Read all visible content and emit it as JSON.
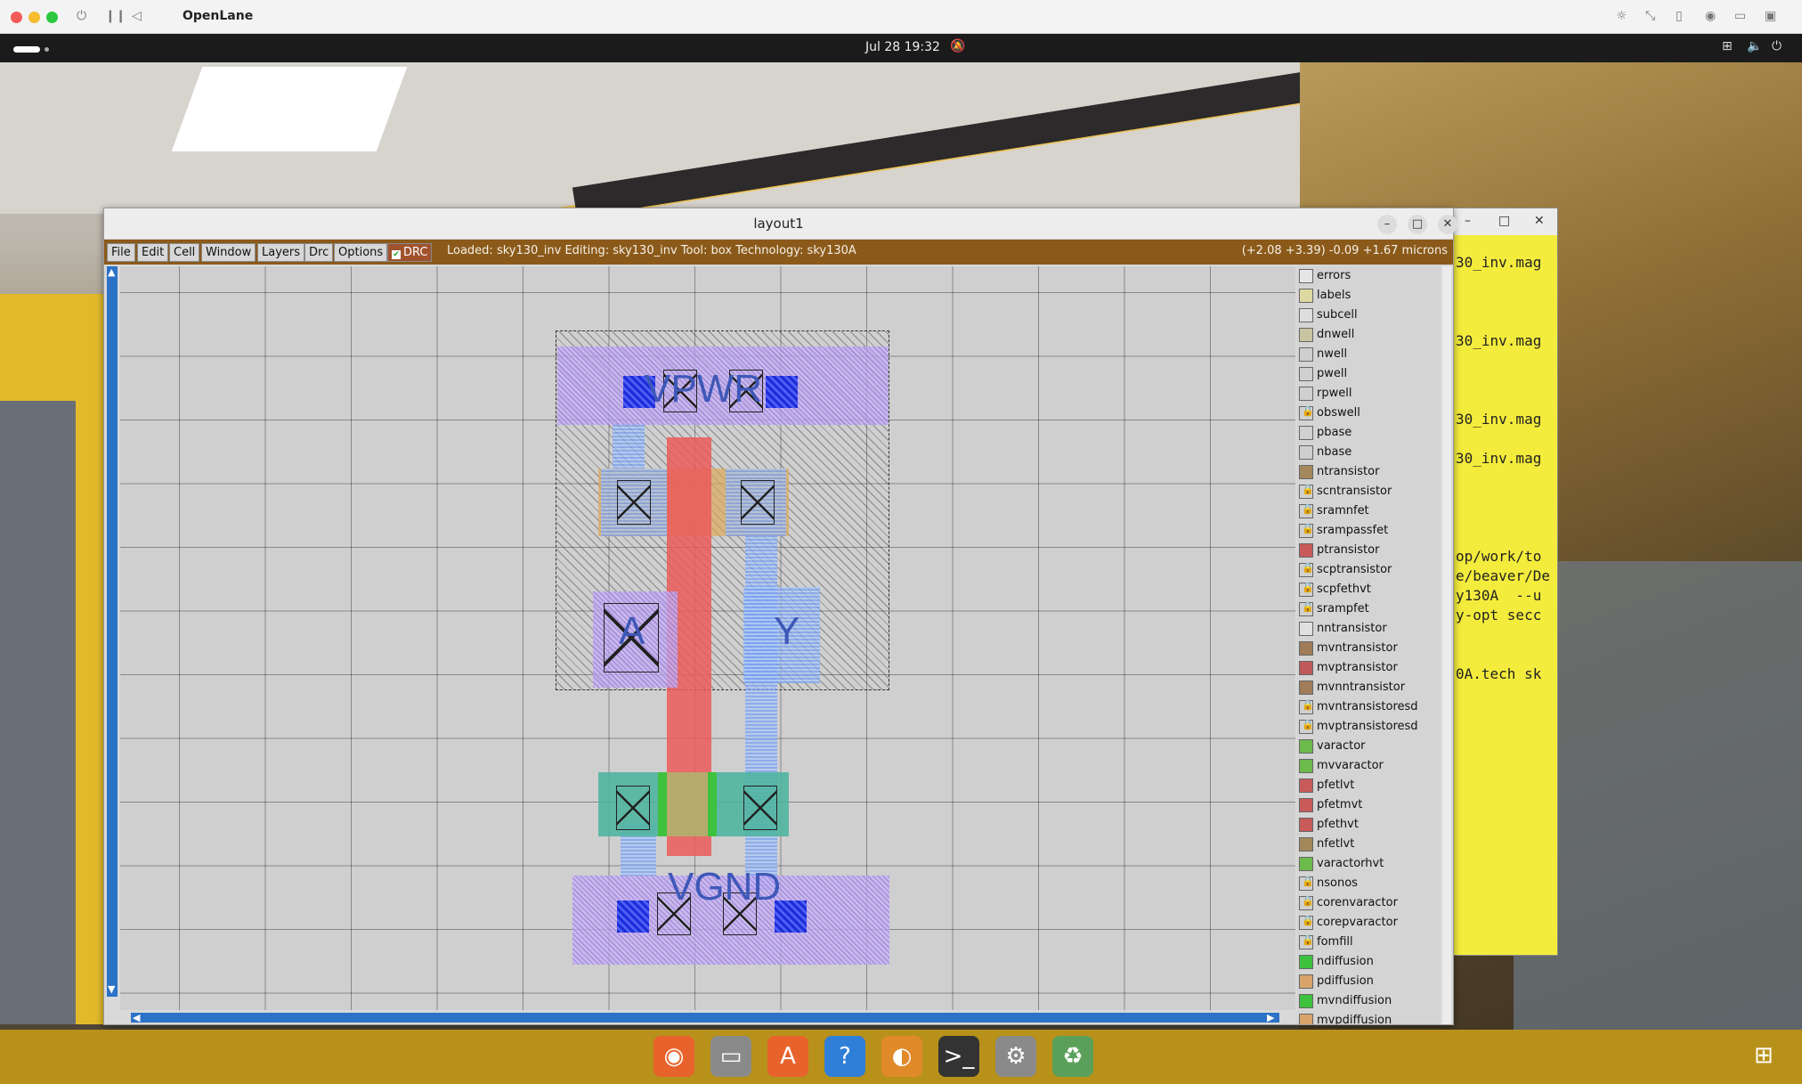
{
  "host": {
    "title": "OpenLane"
  },
  "top_panel": {
    "clock": "Jul 28  19:32"
  },
  "terminal": {
    "lines": [
      "30_inv.mag",
      "",
      "",
      "",
      "30_inv.mag",
      "",
      "",
      "",
      "30_inv.mag",
      "",
      "30_inv.mag",
      "",
      "",
      "",
      "",
      "op/work/to",
      "e/beaver/De",
      "y130A  --u",
      "y-opt secc",
      "",
      "",
      "0A.tech sk"
    ]
  },
  "window": {
    "title": "layout1",
    "menu": [
      "File",
      "Edit",
      "Cell",
      "Window",
      "Layers",
      "Drc",
      "Options"
    ],
    "drc_label": "DRC",
    "status": "Loaded: sky130_inv  Editing: sky130_inv  Tool: box   Technology: sky130A",
    "coords": "(+2.08 +3.39) -0.09 +1.67 microns"
  },
  "pins": {
    "vpwr": "VPWR",
    "vgnd": "VGND",
    "a": "A",
    "y": "Y"
  },
  "layers": [
    {
      "name": "errors",
      "color": "#e6e6e6",
      "locked": false
    },
    {
      "name": "labels",
      "color": "#dcd8a0",
      "locked": false
    },
    {
      "name": "subcell",
      "color": "#dedede",
      "locked": false
    },
    {
      "name": "dnwell",
      "color": "#c8c4a0",
      "locked": false
    },
    {
      "name": "nwell",
      "color": "#cfcfcf",
      "locked": false
    },
    {
      "name": "pwell",
      "color": "#d0d0d0",
      "locked": false
    },
    {
      "name": "rpwell",
      "color": "#d0d0d0",
      "locked": false
    },
    {
      "name": "obswell",
      "color": "#d0d0d0",
      "locked": true
    },
    {
      "name": "pbase",
      "color": "#d0d0d0",
      "locked": false
    },
    {
      "name": "nbase",
      "color": "#cfcfcf",
      "locked": false
    },
    {
      "name": "ntransistor",
      "color": "#a3885c",
      "locked": false
    },
    {
      "name": "scntransistor",
      "color": "#d0d0d0",
      "locked": true
    },
    {
      "name": "sramnfet",
      "color": "#d0d0d0",
      "locked": true
    },
    {
      "name": "srampassfet",
      "color": "#d0d0d0",
      "locked": true
    },
    {
      "name": "ptransistor",
      "color": "#c85a5a",
      "locked": false
    },
    {
      "name": "scptransistor",
      "color": "#d0d0d0",
      "locked": true
    },
    {
      "name": "scpfethvt",
      "color": "#d0d0d0",
      "locked": true
    },
    {
      "name": "srampfet",
      "color": "#d0d0d0",
      "locked": true
    },
    {
      "name": "nntransistor",
      "color": "#e0e0e0",
      "locked": false
    },
    {
      "name": "mvntransistor",
      "color": "#a07c58",
      "locked": false
    },
    {
      "name": "mvptransistor",
      "color": "#c05a5a",
      "locked": false
    },
    {
      "name": "mvnntransistor",
      "color": "#a07c58",
      "locked": false
    },
    {
      "name": "mvntransistoresd",
      "color": "#d0d0d0",
      "locked": true
    },
    {
      "name": "mvptransistoresd",
      "color": "#d0d0d0",
      "locked": true
    },
    {
      "name": "varactor",
      "color": "#6cbb4c",
      "locked": false
    },
    {
      "name": "mvvaractor",
      "color": "#6cbb4c",
      "locked": false
    },
    {
      "name": "pfetlvt",
      "color": "#c85a5a",
      "locked": false
    },
    {
      "name": "pfetmvt",
      "color": "#c85a5a",
      "locked": false
    },
    {
      "name": "pfethvt",
      "color": "#c85a5a",
      "locked": false
    },
    {
      "name": "nfetlvt",
      "color": "#a3885c",
      "locked": false
    },
    {
      "name": "varactorhvt",
      "color": "#6cbb4c",
      "locked": false
    },
    {
      "name": "nsonos",
      "color": "#d0d0d0",
      "locked": true
    },
    {
      "name": "corenvaractor",
      "color": "#d0d0d0",
      "locked": true
    },
    {
      "name": "corepvaractor",
      "color": "#d0d0d0",
      "locked": true
    },
    {
      "name": "fomfill",
      "color": "#d0d0d0",
      "locked": true
    },
    {
      "name": "ndiffusion",
      "color": "#3ec23e",
      "locked": false
    },
    {
      "name": "pdiffusion",
      "color": "#d8a46c",
      "locked": false
    },
    {
      "name": "mvndiffusion",
      "color": "#3ec23e",
      "locked": false
    },
    {
      "name": "mvpdiffusion",
      "color": "#d8a46c",
      "locked": false
    }
  ],
  "dock": [
    {
      "name": "firefox",
      "color": "#e8622c"
    },
    {
      "name": "files",
      "color": "#8a8a8a"
    },
    {
      "name": "app-center",
      "color": "#e8622c"
    },
    {
      "name": "help",
      "color": "#2f7fd8"
    },
    {
      "name": "blender",
      "color": "#e08a2a"
    },
    {
      "name": "terminal",
      "color": "#333333"
    },
    {
      "name": "settings",
      "color": "#8a8a8a"
    },
    {
      "name": "trash",
      "color": "#5aa05a"
    }
  ]
}
